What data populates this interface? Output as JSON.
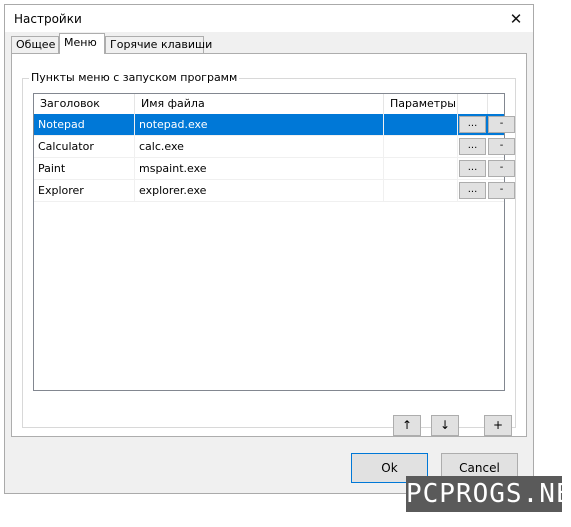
{
  "window": {
    "title": "Настройки"
  },
  "tabs": [
    {
      "label": "Общее"
    },
    {
      "label": "Меню"
    },
    {
      "label": "Горячие клавиши"
    }
  ],
  "group": {
    "title": "Пункты меню с запуском программ"
  },
  "list": {
    "columns": [
      "Заголовок",
      "Имя файла",
      "Параметры"
    ],
    "rows": [
      {
        "title": "Notepad",
        "file": "notepad.exe",
        "params": "",
        "browse": "...",
        "remove": "-",
        "selected": true
      },
      {
        "title": "Calculator",
        "file": "calc.exe",
        "params": "",
        "browse": "...",
        "remove": "-"
      },
      {
        "title": "Paint",
        "file": "mspaint.exe",
        "params": "",
        "browse": "...",
        "remove": "-"
      },
      {
        "title": "Explorer",
        "file": "explorer.exe",
        "params": "",
        "browse": "...",
        "remove": "-"
      }
    ]
  },
  "toolbar": {
    "up": "↑",
    "down": "↓",
    "add": "+"
  },
  "buttons": {
    "ok": "Ok",
    "cancel": "Cancel"
  },
  "watermark": "PCPROGS.NET",
  "colors": {
    "selection": "#0078d7",
    "dialog_bg": "#f0f0f0",
    "watermark_bg": "#5a5a5a"
  }
}
